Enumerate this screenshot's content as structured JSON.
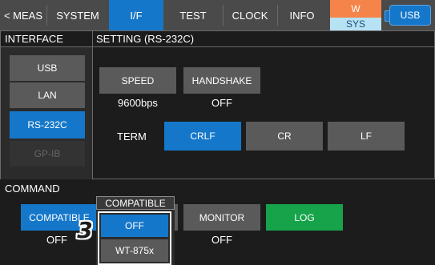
{
  "tabs": [
    {
      "label": "< MEAS",
      "active": false
    },
    {
      "label": "SYSTEM",
      "active": false
    },
    {
      "label": "I/F",
      "active": true
    },
    {
      "label": "TEST",
      "active": false
    },
    {
      "label": "CLOCK",
      "active": false
    },
    {
      "label": "INFO",
      "active": false
    }
  ],
  "status": {
    "sys_top": "W",
    "sys_label": "SYS",
    "usb_label": "USB"
  },
  "interface": {
    "title": "INTERFACE",
    "items": [
      {
        "label": "USB",
        "state": "normal"
      },
      {
        "label": "LAN",
        "state": "normal"
      },
      {
        "label": "RS-232C",
        "state": "selected"
      },
      {
        "label": "GP-IB",
        "state": "disabled"
      }
    ]
  },
  "setting": {
    "title": "SETTING (RS-232C)",
    "speed_label": "SPEED",
    "speed_value": "9600bps",
    "handshake_label": "HANDSHAKE",
    "handshake_value": "OFF",
    "term_label": "TERM",
    "term_options": [
      {
        "label": "CRLF",
        "selected": true
      },
      {
        "label": "CR",
        "selected": false
      },
      {
        "label": "LF",
        "selected": false
      }
    ]
  },
  "command": {
    "title": "COMMAND",
    "compatible_label": "COMPATIBLE",
    "compatible_value": "OFF",
    "monitor_label": "MONITOR",
    "monitor_value": "OFF",
    "log_label": "LOG"
  },
  "popup": {
    "title": "COMPATIBLE",
    "options": [
      {
        "label": "OFF",
        "selected": true
      },
      {
        "label": "WT-875x",
        "selected": false
      }
    ]
  },
  "step_number": "3",
  "colors": {
    "accent": "#1577c9",
    "log_green": "#16a34a",
    "sys_orange": "#f4844a"
  }
}
